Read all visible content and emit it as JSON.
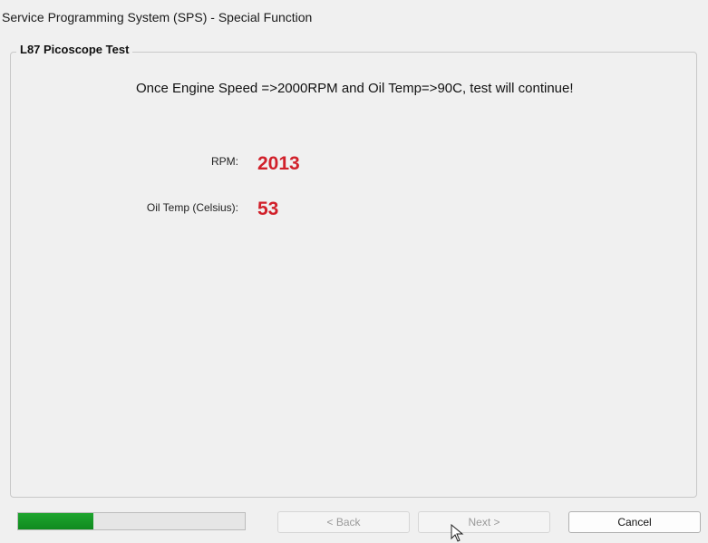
{
  "window": {
    "title": "Service Programming System (SPS) - Special Function"
  },
  "group": {
    "title": "L87 Picoscope Test",
    "instruction": "Once Engine Speed =>2000RPM and Oil Temp=>90C, test will continue!"
  },
  "readings": {
    "rpm_label": "RPM:",
    "rpm_value": "2013",
    "oil_label": "Oil Temp (Celsius):",
    "oil_value": "53",
    "value_color": "#d1202a"
  },
  "progress": {
    "fraction": 0.33,
    "color": "#1ea52e"
  },
  "buttons": {
    "back_label": "< Back",
    "next_label": "Next >",
    "cancel_label": "Cancel"
  },
  "icons": {
    "cursor": "mouse-pointer-icon"
  }
}
